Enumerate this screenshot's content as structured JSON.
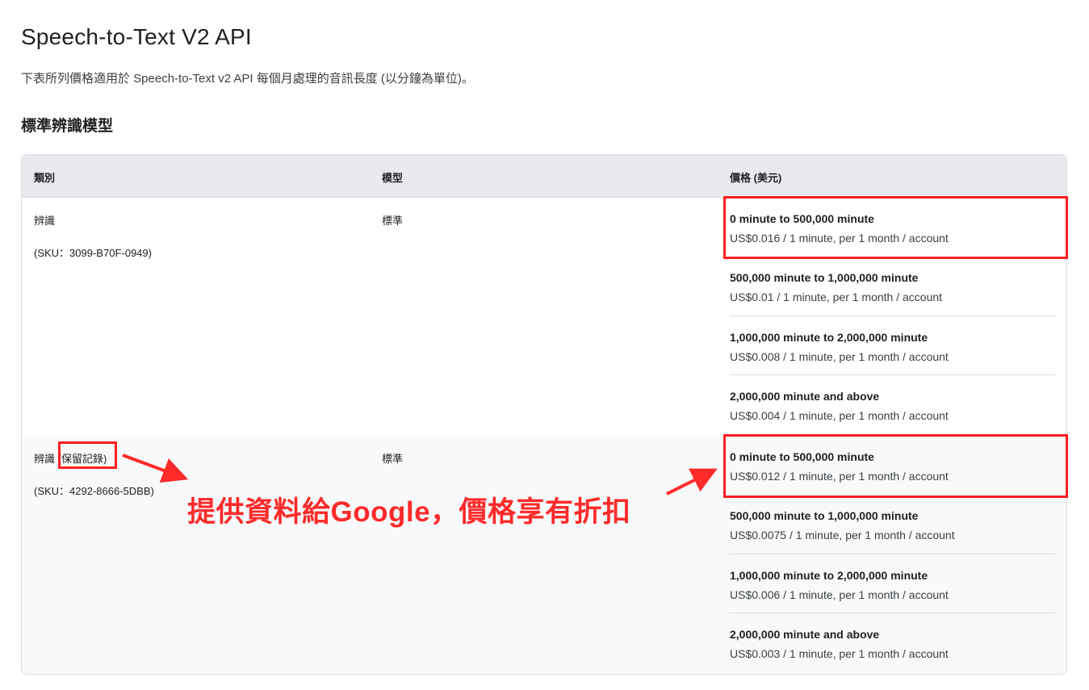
{
  "page": {
    "title": "Speech-to-Text V2 API",
    "description": "下表所列價格適用於 Speech-to-Text v2 API 每個月處理的音訊長度 (以分鐘為單位)。",
    "section_heading": "標準辨識模型"
  },
  "table": {
    "headers": [
      "類別",
      "模型",
      "價格 (美元)"
    ],
    "rows": [
      {
        "category": "辨識",
        "category_suffix": "",
        "sku": "(SKU：3099-B70F-0949)",
        "model": "標準",
        "tiers": [
          {
            "range": "0 minute to 500,000 minute",
            "price": "US$0.016 / 1 minute, per 1 month / account"
          },
          {
            "range": "500,000 minute to 1,000,000 minute",
            "price": "US$0.01 / 1 minute, per 1 month / account"
          },
          {
            "range": "1,000,000 minute to 2,000,000 minute",
            "price": "US$0.008 / 1 minute, per 1 month / account"
          },
          {
            "range": "2,000,000 minute and above",
            "price": "US$0.004 / 1 minute, per 1 month / account"
          }
        ]
      },
      {
        "category": "辨識",
        "category_suffix": " (保留記錄)",
        "sku": "(SKU：4292-8666-5DBB)",
        "model": "標準",
        "tiers": [
          {
            "range": "0 minute to 500,000 minute",
            "price": "US$0.012 / 1 minute, per 1 month / account"
          },
          {
            "range": "500,000 minute to 1,000,000 minute",
            "price": "US$0.0075 / 1 minute, per 1 month / account"
          },
          {
            "range": "1,000,000 minute to 2,000,000 minute",
            "price": "US$0.006 / 1 minute, per 1 month / account"
          },
          {
            "range": "2,000,000 minute and above",
            "price": "US$0.003 / 1 minute, per 1 month / account"
          }
        ]
      }
    ]
  },
  "annotation": {
    "text": "提供資料給Google，價格享有折扣",
    "color": "#ff2a2a"
  }
}
